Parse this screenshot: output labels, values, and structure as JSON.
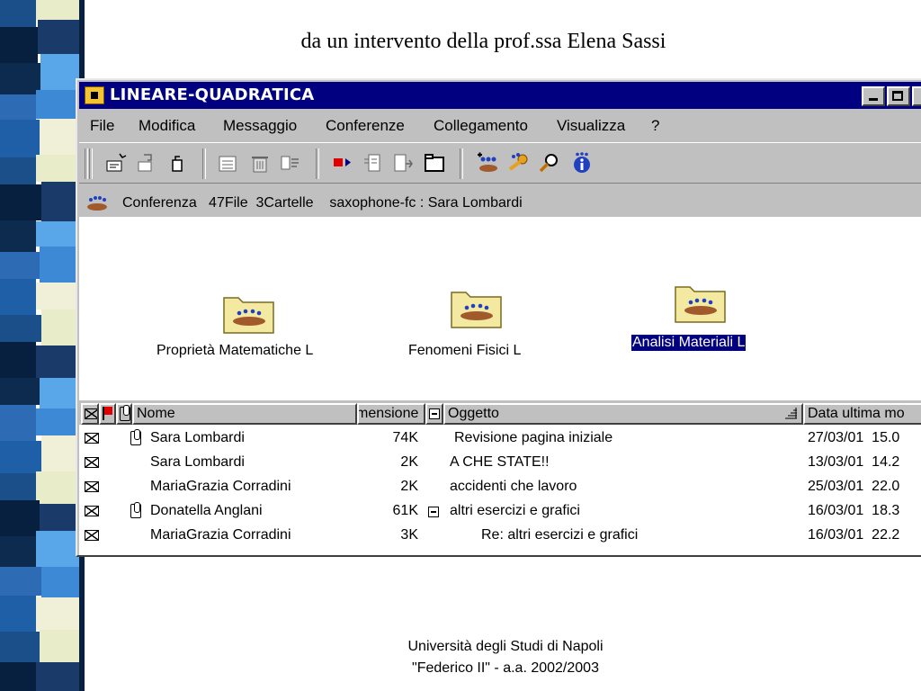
{
  "slide": {
    "title": "da un intervento della prof.ssa Elena Sassi",
    "footer_line1": "Università degli Studi di Napoli",
    "footer_line2": "\"Federico II\" - a.a. 2002/2003"
  },
  "window": {
    "title": "LINEARE-QUADRATICA",
    "menu": [
      "File",
      "Modifica",
      "Messaggio",
      "Conferenze",
      "Collegamento",
      "Visualizza",
      "?"
    ],
    "status_line": "Conferenza   47File  3Cartelle    saxophone-fc : Sara Lombardi"
  },
  "folders": [
    {
      "label": "Proprietà Matematiche L",
      "selected": false
    },
    {
      "label": "Fenomeni Fisici L",
      "selected": false
    },
    {
      "label": "Analisi Materiali L",
      "selected": true
    }
  ],
  "list": {
    "columns": [
      "Nome",
      "mensione",
      "Oggetto",
      "Data ultima mo"
    ],
    "rows": [
      {
        "attachment": true,
        "name": "Sara Lombardi",
        "size": "74K",
        "thread_toggle": false,
        "subject": "Revisione pagina iniziale",
        "date": "27/03/01  15.0"
      },
      {
        "attachment": false,
        "name": "Sara Lombardi",
        "size": "2K",
        "thread_toggle": false,
        "subject": "A CHE STATE!!",
        "date": "13/03/01  14.2"
      },
      {
        "attachment": false,
        "name": "MariaGrazia Corradini",
        "size": "2K",
        "thread_toggle": false,
        "subject": "accidenti che lavoro",
        "date": "25/03/01  22.0"
      },
      {
        "attachment": true,
        "name": "Donatella Anglani",
        "size": "61K",
        "thread_toggle": true,
        "subject": "altri esercizi e grafici",
        "date": "16/03/01  18.3"
      },
      {
        "attachment": false,
        "name": "MariaGrazia Corradini",
        "size": "3K",
        "thread_toggle": false,
        "subject": "Re: altri esercizi e grafici",
        "date": "16/03/01  22.2"
      }
    ]
  },
  "colors": {
    "titlebar": "#000080",
    "window_face": "#c0c0c0",
    "folder": "#f3e9a0",
    "selection": "#000080"
  },
  "icons": [
    "new-message-icon",
    "reply-icon",
    "attach-icon",
    "print-icon",
    "delete-icon",
    "forward-icon",
    "flag-icon",
    "read-icon",
    "move-icon",
    "folder-icon",
    "add-user-icon",
    "keys-icon",
    "search-icon",
    "info-icon"
  ]
}
